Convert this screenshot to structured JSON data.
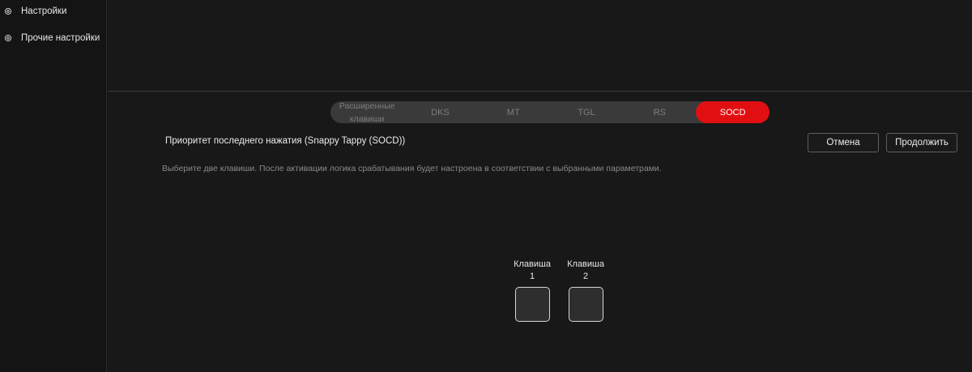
{
  "sidebar": {
    "items": [
      {
        "label": "Настройки",
        "icon": "gear-icon"
      },
      {
        "label": "Прочие настройки",
        "icon": "gear-icon"
      }
    ]
  },
  "tabs": [
    {
      "label_line1": "Расширенные",
      "label_line2": "клавиши",
      "active": false
    },
    {
      "label": "DKS",
      "active": false
    },
    {
      "label": "MT",
      "active": false
    },
    {
      "label": "TGL",
      "active": false
    },
    {
      "label": "RS",
      "active": false
    },
    {
      "label": "SOCD",
      "active": true
    }
  ],
  "section": {
    "title": "Приоритет последнего нажатия (Snappy Tappy (SOCD))",
    "hint": "Выберите две клавиши. После активации логика срабатывания будет настроена в соответствии с выбранными параметрами."
  },
  "actions": {
    "cancel_label": "Отмена",
    "continue_label": "Продолжить"
  },
  "keys": [
    {
      "label_line1": "Клавиша",
      "label_line2": "1"
    },
    {
      "label_line1": "Клавиша",
      "label_line2": "2"
    }
  ],
  "colors": {
    "accent": "#e10f12",
    "background": "#181818",
    "sidebar": "#141414"
  }
}
